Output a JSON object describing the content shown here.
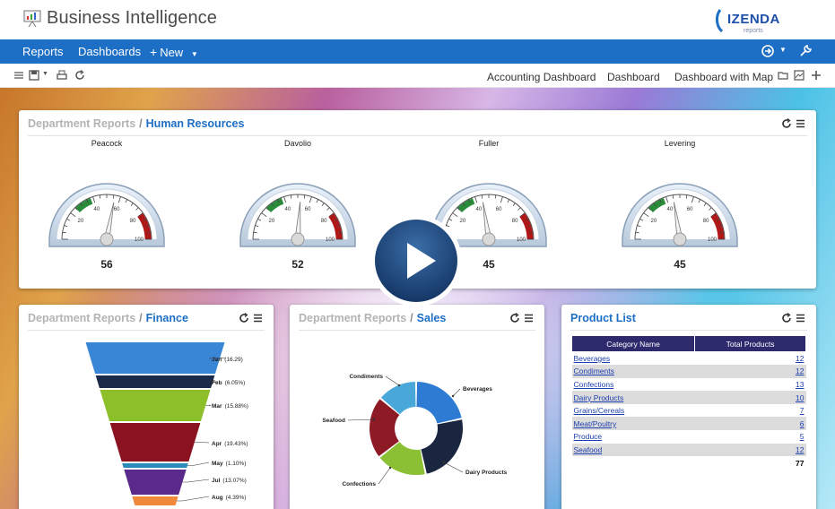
{
  "header": {
    "title": "Business Intelligence",
    "brand_name": "IZENDA",
    "brand_sub": "reports"
  },
  "nav": {
    "reports": "Reports",
    "dashboards": "Dashboards",
    "new_label": "New"
  },
  "tabs": [
    {
      "label": "Accounting Dashboard",
      "active": false
    },
    {
      "label": "Dashboard",
      "active": true
    },
    {
      "label": "Dashboard with Map",
      "active": false
    }
  ],
  "panels": {
    "hr": {
      "category": "Department Reports",
      "sep": "/",
      "title": "Human Resources"
    },
    "finance": {
      "category": "Department Reports",
      "sep": "/",
      "title": "Finance"
    },
    "sales": {
      "category": "Department Reports",
      "sep": "/",
      "title": "Sales"
    },
    "products": {
      "title": "Product List"
    }
  },
  "gauges": [
    {
      "name": "Peacock",
      "value": 56
    },
    {
      "name": "Davolio",
      "value": 52
    },
    {
      "name": "Fuller",
      "value": 45
    },
    {
      "name": "Levering",
      "value": 45
    }
  ],
  "gauge_ticks": [
    "20",
    "40",
    "60",
    "80",
    "100"
  ],
  "funnel": [
    {
      "label": "Jan",
      "percent": "(16.29)",
      "color": "#3a86d6"
    },
    {
      "label": "Feb",
      "percent": "(6.05%)",
      "color": "#1b2a48"
    },
    {
      "label": "Mar",
      "percent": "(15.88%)",
      "color": "#8cbf2a"
    },
    {
      "label": "Apr",
      "percent": "(19.43%)",
      "color": "#8b1221"
    },
    {
      "label": "May",
      "percent": "(1.10%)",
      "color": "#2a8ab8"
    },
    {
      "label": "Jul",
      "percent": "(13.07%)",
      "color": "#5a2a8a"
    },
    {
      "label": "Aug",
      "percent": "(4.39%)",
      "color": "#f08a3a"
    }
  ],
  "donut": [
    {
      "label": "Beverages",
      "color": "#2e7bd4"
    },
    {
      "label": "Dairy Products",
      "color": "#1a2640"
    },
    {
      "label": "Confections",
      "color": "#8cc034"
    },
    {
      "label": "Seafood",
      "color": "#8e1a26"
    },
    {
      "label": "Condiments",
      "color": "#49a8d9"
    }
  ],
  "product_table": {
    "columns": [
      "Category Name",
      "Total Products"
    ],
    "rows": [
      {
        "name": "Beverages",
        "count": "12"
      },
      {
        "name": "Condiments",
        "count": "12"
      },
      {
        "name": "Confections",
        "count": "13"
      },
      {
        "name": "Dairy Products",
        "count": "10"
      },
      {
        "name": "Grains/Cereals",
        "count": "7"
      },
      {
        "name": "Meat/Poultry",
        "count": "6"
      },
      {
        "name": "Produce",
        "count": "5"
      },
      {
        "name": "Seafood",
        "count": "12"
      }
    ],
    "total": "77"
  },
  "colors": {
    "nav_blue": "#1d6fc6",
    "table_header": "#2e2a6e",
    "link_blue": "#1d3fb0"
  }
}
